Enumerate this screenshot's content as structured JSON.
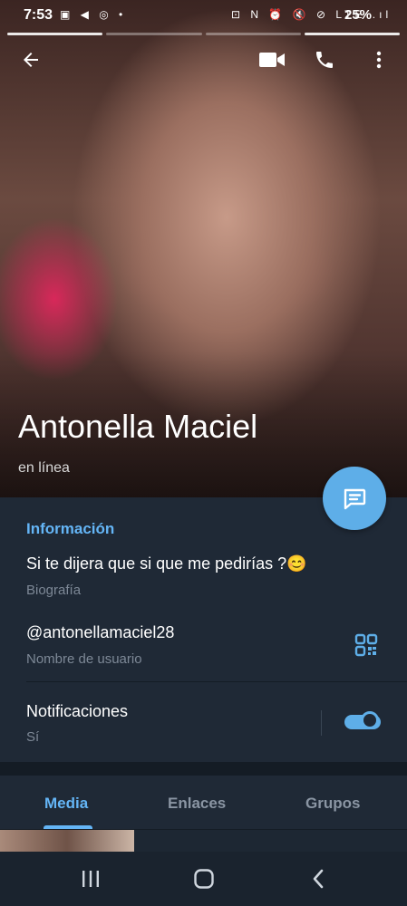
{
  "status_bar": {
    "time": "7:53",
    "left_icons": "▣ ◀ ◎ •",
    "right_icons": "⊡ N ⏰ 🔇 ⊘ LTE .ıl",
    "battery": "25%"
  },
  "profile": {
    "name": "Antonella Maciel",
    "status": "en línea"
  },
  "info": {
    "section_title": "Información",
    "bio": "Si te dijera que si que me pedirías ?😊",
    "bio_label": "Biografía",
    "username": "@antonellamaciel28",
    "username_label": "Nombre de usuario",
    "notifications": "Notificaciones",
    "notifications_value": "Sí",
    "notifications_on": true
  },
  "tabs": [
    "Media",
    "Enlaces",
    "Grupos"
  ],
  "active_tab": "Media",
  "colors": {
    "accent": "#64b5f6",
    "fab": "#5eaee8",
    "background": "#1f2936"
  },
  "icons": {
    "back": "arrow-left-icon",
    "video": "video-call-icon",
    "phone": "phone-icon",
    "more": "more-vertical-icon",
    "message": "message-icon",
    "qr": "qr-code-icon"
  }
}
